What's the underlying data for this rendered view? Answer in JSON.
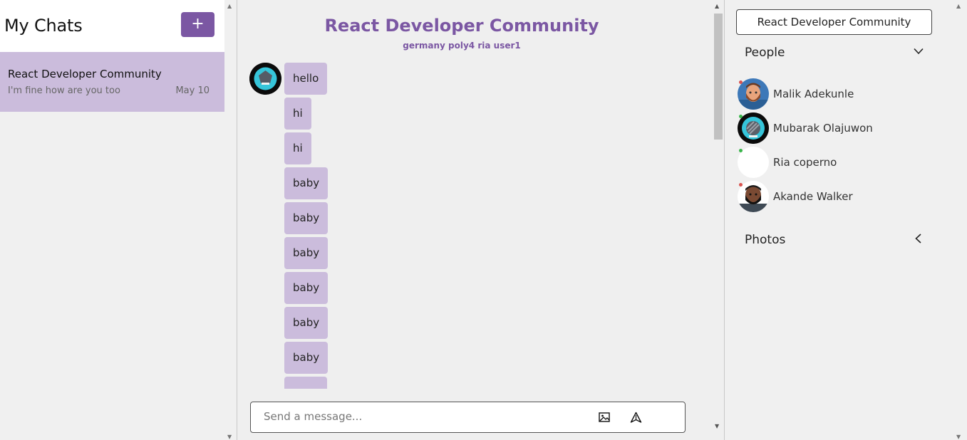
{
  "sidebar": {
    "title": "My Chats",
    "new_chat_label": "+",
    "chats": [
      {
        "name": "React Developer Community",
        "preview": "I'm fine how are you too",
        "date": "May 10"
      }
    ]
  },
  "chat": {
    "title": "React Developer Community",
    "members": "germany poly4 ria user1",
    "messages": [
      "hello",
      "hi",
      "hi",
      "baby",
      "baby",
      "baby",
      "baby",
      "baby",
      "baby"
    ],
    "composer_placeholder": "Send a message..."
  },
  "details": {
    "group_name": "React Developer Community",
    "people_label": "People",
    "photos_label": "Photos",
    "people": [
      {
        "name": "Malik Adekunle",
        "status": "offline",
        "status_color": "#d9534f"
      },
      {
        "name": "Mubarak Olajuwon",
        "status": "online",
        "status_color": "#39b54a"
      },
      {
        "name": "Ria coperno",
        "status": "online",
        "status_color": "#39b54a"
      },
      {
        "name": "Akande Walker",
        "status": "offline",
        "status_color": "#d9534f"
      }
    ]
  },
  "colors": {
    "accent": "#7b57a3",
    "bubble": "#cbbcdc",
    "selected_chat": "#cbbcdc"
  }
}
